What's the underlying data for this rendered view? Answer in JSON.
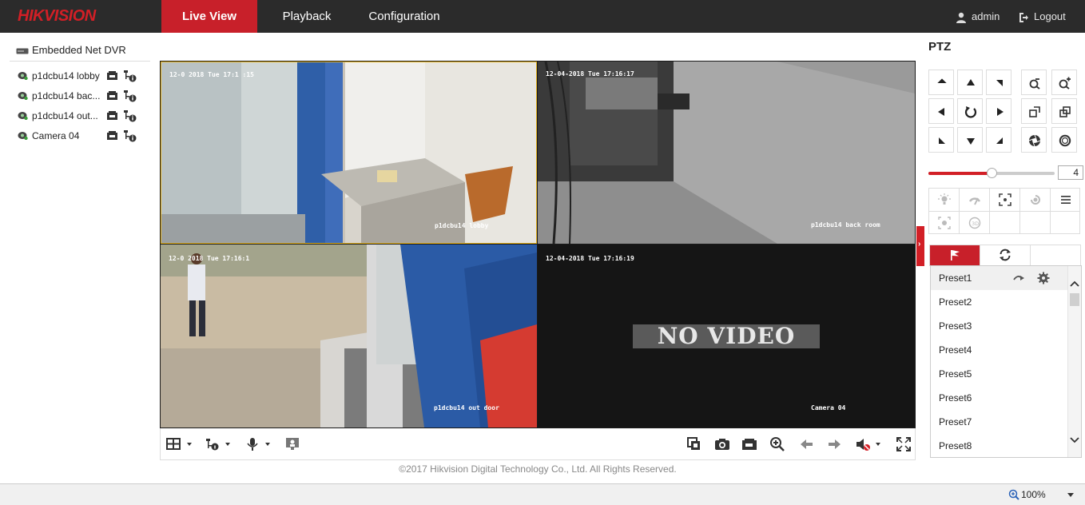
{
  "app": {
    "logo": "HIKVISION",
    "nav": [
      "Live View",
      "Playback",
      "Configuration"
    ],
    "active_tab": "Live View",
    "user": "admin",
    "logout": "Logout"
  },
  "device_tree": {
    "root": "Embedded Net DVR",
    "cameras": [
      {
        "label": "p1dcbu14 lobby"
      },
      {
        "label": "p1dcbu14 bac..."
      },
      {
        "label": "p1dcbu14 out..."
      },
      {
        "label": "Camera 04"
      }
    ]
  },
  "video": {
    "tiles": [
      {
        "timestamp": "12-0   2018 Tue 17:1 :15",
        "name": "p1dcbu14 lobby"
      },
      {
        "timestamp": "12-04-2018 Tue 17:16:17",
        "name": "p1dcbu14 back room"
      },
      {
        "timestamp": "12-0  2018 Tue 17:16:1",
        "name": "p1dcbu14 out door"
      },
      {
        "timestamp": "12-04-2018 Tue 17:16:19",
        "name": "Camera 04"
      }
    ],
    "no_video_text": "NO VIDEO"
  },
  "footer": {
    "copyright": "©2017 Hikvision Digital Technology Co., Ltd. All Rights Reserved."
  },
  "ptz": {
    "title": "PTZ",
    "speed": "4",
    "speed_fraction": 0.5,
    "presets": [
      "Preset1",
      "Preset2",
      "Preset3",
      "Preset4",
      "Preset5",
      "Preset6",
      "Preset7",
      "Preset8"
    ]
  },
  "statusbar": {
    "zoom": "100%"
  },
  "colors": {
    "brand_red": "#c8202a",
    "topbar": "#2b2b2b"
  }
}
